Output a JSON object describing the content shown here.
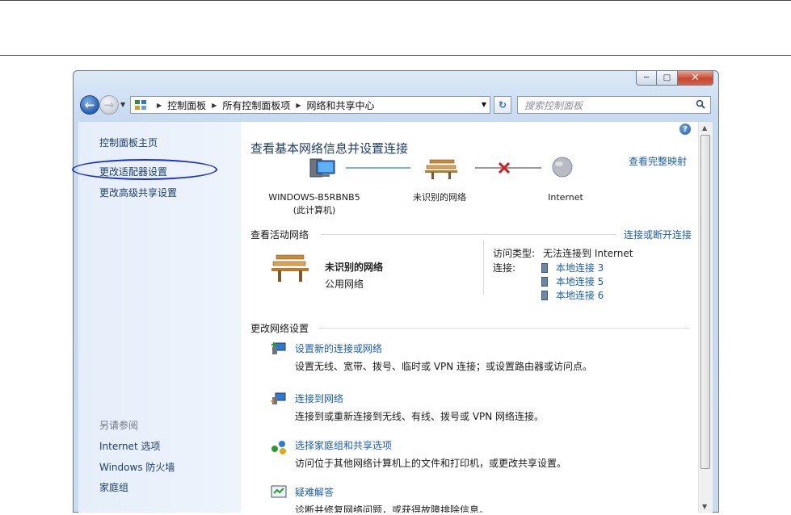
{
  "address": {
    "crumbs": [
      "控制面板",
      "所有控制面板项",
      "网络和共享中心"
    ],
    "search_placeholder": "搜索控制面板"
  },
  "window": {
    "minimize_icon": "minimize-icon",
    "maximize_icon": "maximize-icon",
    "close_icon": "close-icon"
  },
  "sidebar": {
    "items": [
      "控制面板主页",
      "更改适配器设置",
      "更改高级共享设置"
    ],
    "see_also": "另请参阅",
    "see_also_items": [
      "Internet 选项",
      "Windows 防火墙",
      "家庭组"
    ]
  },
  "main": {
    "title": "查看基本网络信息并设置连接",
    "full_map": "查看完整映射",
    "map": {
      "computer_name": "WINDOWS-B5RBNB5",
      "computer_sub": "(此计算机)",
      "network_name": "未识别的网络",
      "internet": "Internet"
    },
    "active": {
      "heading": "查看活动网络",
      "connect_link": "连接或断开连接",
      "network_name": "未识别的网络",
      "network_type": "公用网络",
      "access_label": "访问类型:",
      "access_value": "无法连接到 Internet",
      "conn_label": "连接:",
      "connections": [
        "本地连接 3",
        "本地连接 5",
        "本地连接 6"
      ]
    },
    "change": {
      "heading": "更改网络设置",
      "tasks": [
        {
          "title": "设置新的连接或网络",
          "desc": "设置无线、宽带、拨号、临时或 VPN 连接；或设置路由器或访问点。"
        },
        {
          "title": "连接到网络",
          "desc": "连接到或重新连接到无线、有线、拨号或 VPN 网络连接。"
        },
        {
          "title": "选择家庭组和共享选项",
          "desc": "访问位于其他网络计算机上的文件和打印机，或更改共享设置。"
        },
        {
          "title": "疑难解答",
          "desc": "诊断并修复网络问题，或获得故障排除信息。"
        }
      ]
    }
  },
  "colors": {
    "link": "#1b5eb3",
    "circle": "#1b2fc9",
    "sidebar_bg": "#e5eefa"
  }
}
